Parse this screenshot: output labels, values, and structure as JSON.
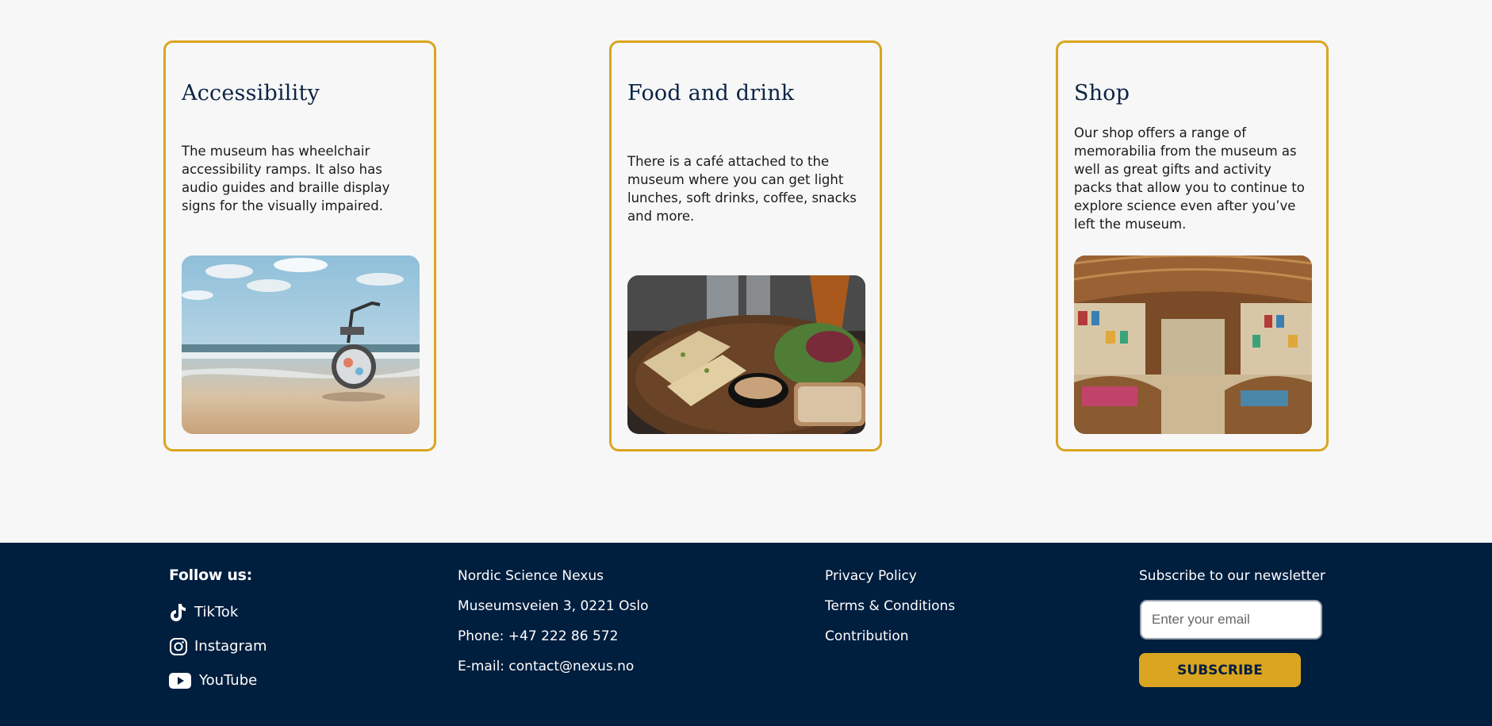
{
  "cards": [
    {
      "title": "Accessibility",
      "text": "The museum has wheelchair accessibility ramps. It also has audio guides and braille display signs for the visually impaired.",
      "image": "wheelchair-on-beach-photo"
    },
    {
      "title": "Food and drink",
      "text": "There is a café attached to the museum where you can get light lunches, soft drinks, coffee, snacks and more.",
      "image": "cafe-plate-photo"
    },
    {
      "title": "Shop",
      "text": "Our shop offers a range of memorabilia from the museum as well as great gifts and activity packs that allow you to continue to explore science even after you’ve left the museum.",
      "image": "museum-shop-interior-photo"
    }
  ],
  "footer": {
    "follow_title": "Follow us:",
    "social": [
      {
        "label": "TikTok",
        "icon": "tiktok-icon"
      },
      {
        "label": "Instagram",
        "icon": "instagram-icon"
      },
      {
        "label": "YouTube",
        "icon": "youtube-icon"
      }
    ],
    "contact": {
      "name": "Nordic Science Nexus",
      "address": "Museumsveien 3, 0221 Oslo",
      "phone": "Phone: +47 222 86 572",
      "email": "E-mail: contact@nexus.no"
    },
    "links": [
      "Privacy Policy",
      "Terms & Conditions",
      "Contribution"
    ],
    "newsletter": {
      "title": "Subscribe to our newsletter",
      "placeholder": "Enter your email",
      "button": "SUBSCRIBE"
    }
  },
  "colors": {
    "accent": "#daa520",
    "footer_bg": "#001e3e",
    "heading": "#0d2445",
    "page_bg": "#f7f7f7"
  }
}
